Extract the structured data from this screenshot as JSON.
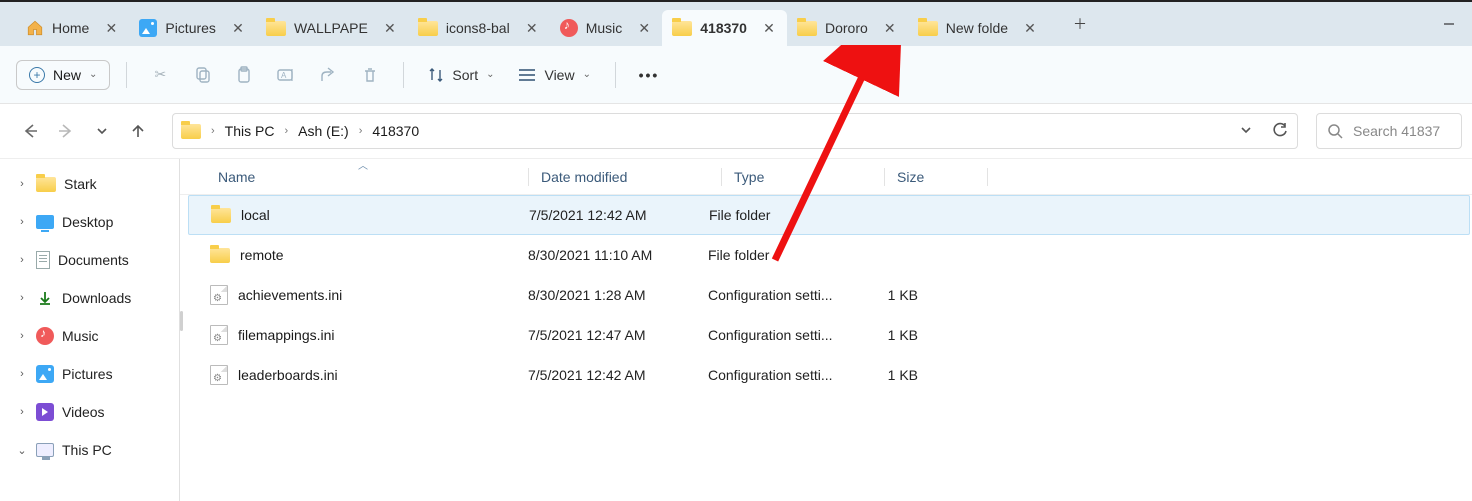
{
  "tabs": [
    {
      "label": "Home",
      "icon": "home"
    },
    {
      "label": "Pictures",
      "icon": "pictures"
    },
    {
      "label": "WALLPAPE",
      "icon": "folder"
    },
    {
      "label": "icons8-bal",
      "icon": "folder"
    },
    {
      "label": "Music",
      "icon": "music"
    },
    {
      "label": "418370",
      "icon": "folder",
      "active": true
    },
    {
      "label": "Dororo",
      "icon": "folder"
    },
    {
      "label": "New folde",
      "icon": "folder"
    }
  ],
  "toolbar": {
    "new_label": "New",
    "sort_label": "Sort",
    "view_label": "View"
  },
  "breadcrumb": {
    "parts": [
      "This PC",
      "Ash (E:)",
      "418370"
    ]
  },
  "search": {
    "placeholder": "Search 41837"
  },
  "sidebar": [
    {
      "label": "Stark",
      "icon": "folder",
      "chev": ">"
    },
    {
      "label": "Desktop",
      "icon": "desktop",
      "chev": ">"
    },
    {
      "label": "Documents",
      "icon": "doc",
      "chev": ">"
    },
    {
      "label": "Downloads",
      "icon": "download",
      "chev": ">"
    },
    {
      "label": "Music",
      "icon": "music",
      "chev": ">"
    },
    {
      "label": "Pictures",
      "icon": "pictures",
      "chev": ">"
    },
    {
      "label": "Videos",
      "icon": "videos",
      "chev": ">"
    },
    {
      "label": "This PC",
      "icon": "thispc",
      "chev": "v"
    }
  ],
  "columns": {
    "name": "Name",
    "date": "Date modified",
    "type": "Type",
    "size": "Size"
  },
  "rows": [
    {
      "name": "local",
      "icon": "folder",
      "date": "7/5/2021 12:42 AM",
      "type": "File folder",
      "size": "",
      "selected": true
    },
    {
      "name": "remote",
      "icon": "folder",
      "date": "8/30/2021 11:10 AM",
      "type": "File folder",
      "size": ""
    },
    {
      "name": "achievements.ini",
      "icon": "ini",
      "date": "8/30/2021 1:28 AM",
      "type": "Configuration setti...",
      "size": "1 KB"
    },
    {
      "name": "filemappings.ini",
      "icon": "ini",
      "date": "7/5/2021 12:47 AM",
      "type": "Configuration setti...",
      "size": "1 KB"
    },
    {
      "name": "leaderboards.ini",
      "icon": "ini",
      "date": "7/5/2021 12:42 AM",
      "type": "Configuration setti...",
      "size": "1 KB"
    }
  ]
}
